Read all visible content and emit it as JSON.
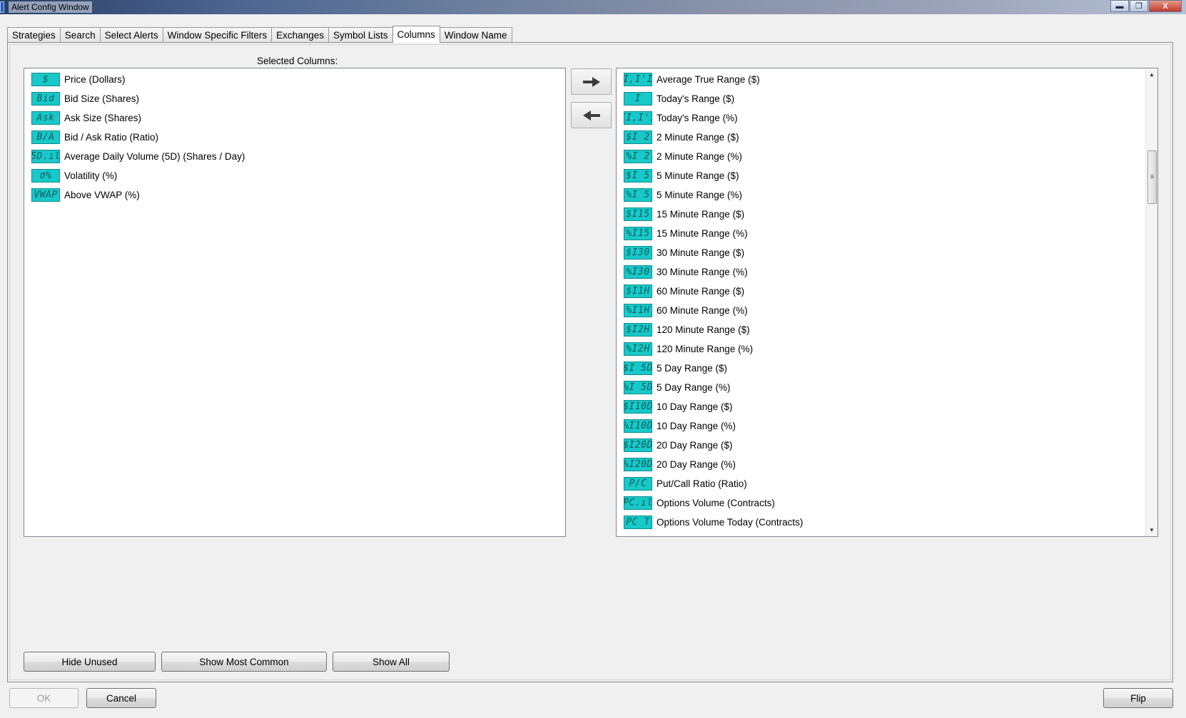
{
  "window": {
    "title": "Alert Config Window",
    "minimize_label": "▬",
    "restore_label": "❐",
    "close_label": "X"
  },
  "tabs": [
    {
      "label": "Strategies",
      "active": false
    },
    {
      "label": "Search",
      "active": false
    },
    {
      "label": "Select Alerts",
      "active": false
    },
    {
      "label": "Window Specific Filters",
      "active": false
    },
    {
      "label": "Exchanges",
      "active": false
    },
    {
      "label": "Symbol Lists",
      "active": false
    },
    {
      "label": "Columns",
      "active": true
    },
    {
      "label": "Window Name",
      "active": false
    }
  ],
  "columns_tab": {
    "selected_label": "Selected Columns:",
    "selected_columns": [
      {
        "icon": "$",
        "label": "Price (Dollars)"
      },
      {
        "icon": "Bid",
        "label": "Bid Size (Shares)"
      },
      {
        "icon": "Ask",
        "label": "Ask Size (Shares)"
      },
      {
        "icon": "B/A",
        "label": "Bid / Ask Ratio (Ratio)"
      },
      {
        "icon": "5D.ıl",
        "label": "Average Daily Volume (5D) (Shares / Day)"
      },
      {
        "icon": "σ%",
        "label": "Volatility (%)"
      },
      {
        "icon": "VWAP",
        "label": "Above VWAP (%)"
      }
    ],
    "available_columns": [
      {
        "icon": "I,I'I",
        "label": "Average True Range ($)"
      },
      {
        "icon": "I",
        "label": "Today's Range ($)"
      },
      {
        "icon": "II,I'I",
        "label": "Today's Range (%)"
      },
      {
        "icon": "$I 2",
        "label": "2 Minute Range ($)"
      },
      {
        "icon": "%I 2",
        "label": "2 Minute Range (%)"
      },
      {
        "icon": "$I 5",
        "label": "5 Minute Range ($)"
      },
      {
        "icon": "%I 5",
        "label": "5 Minute Range (%)"
      },
      {
        "icon": "$I15",
        "label": "15 Minute Range ($)"
      },
      {
        "icon": "%I15",
        "label": "15 Minute Range (%)"
      },
      {
        "icon": "$I30",
        "label": "30 Minute Range ($)"
      },
      {
        "icon": "%I30",
        "label": "30 Minute Range (%)"
      },
      {
        "icon": "$I1H",
        "label": "60 Minute Range ($)"
      },
      {
        "icon": "%I1H",
        "label": "60 Minute Range (%)"
      },
      {
        "icon": "$I2H",
        "label": "120 Minute Range ($)"
      },
      {
        "icon": "%I2H",
        "label": "120 Minute Range (%)"
      },
      {
        "icon": "$I 5D",
        "label": "5 Day Range ($)"
      },
      {
        "icon": "%I 5D",
        "label": "5 Day Range (%)"
      },
      {
        "icon": "$I10D",
        "label": "10 Day Range ($)"
      },
      {
        "icon": "%I10D",
        "label": "10 Day Range (%)"
      },
      {
        "icon": "$I20D",
        "label": "20 Day Range ($)"
      },
      {
        "icon": "%I20D",
        "label": "20 Day Range (%)"
      },
      {
        "icon": "P/C",
        "label": "Put/Call Ratio (Ratio)"
      },
      {
        "icon": "PC.ıl",
        "label": "Options Volume (Contracts)"
      },
      {
        "icon": "PC T",
        "label": "Options Volume Today (Contracts)"
      }
    ],
    "hide_unused_label": "Hide Unused",
    "show_most_common_label": "Show Most Common",
    "show_all_label": "Show All"
  },
  "footer": {
    "ok_label": "OK",
    "cancel_label": "Cancel",
    "flip_label": "Flip"
  },
  "colors": {
    "icon_fill": "#19c8c8",
    "icon_border": "#0c8f8f"
  }
}
